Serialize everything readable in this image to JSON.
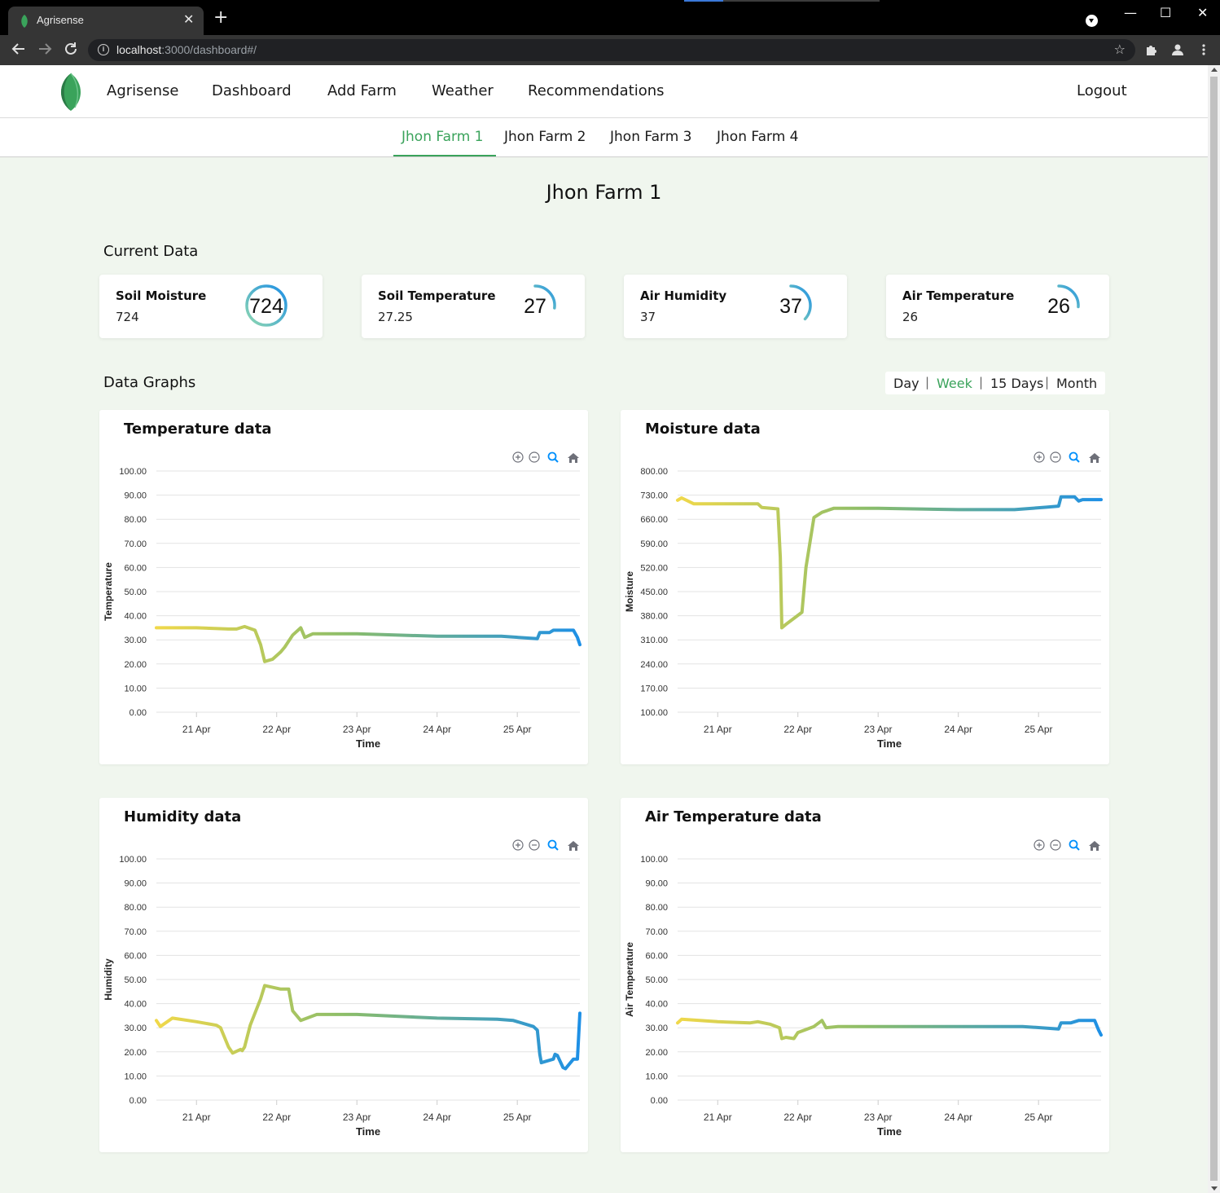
{
  "browser": {
    "tab_title": "Agrisense",
    "tab_close": "✕",
    "new_tab": "+",
    "url_host": "localhost",
    "url_rest": ":3000/dashboard#/",
    "win_min": "—",
    "win_max": "☐",
    "win_close": "✕"
  },
  "nav": {
    "brand": "Agrisense",
    "links": [
      "Dashboard",
      "Add Farm",
      "Weather",
      "Recommendations"
    ],
    "logout": "Logout"
  },
  "farm_tabs": [
    "Jhon Farm 1",
    "Jhon Farm 2",
    "Jhon Farm 3",
    "Jhon Farm 4"
  ],
  "active_farm_tab": 0,
  "page_title": "Jhon Farm 1",
  "current_data": {
    "title": "Current Data",
    "cards": [
      {
        "label": "Soil Moisture",
        "value": "724",
        "gauge": "724",
        "fraction": 1.0
      },
      {
        "label": "Soil Temperature",
        "value": "27.25",
        "gauge": "27",
        "fraction": 0.27
      },
      {
        "label": "Air Humidity",
        "value": "37",
        "gauge": "37",
        "fraction": 0.37
      },
      {
        "label": "Air Temperature",
        "value": "26",
        "gauge": "26",
        "fraction": 0.26
      }
    ]
  },
  "graphs": {
    "title": "Data Graphs",
    "ranges": [
      "Day",
      "Week",
      "15 Days",
      "Month"
    ],
    "active_range": "Week",
    "separator": "|"
  },
  "colors": {
    "accent_green": "#3aa35b",
    "gradient_start": "#f0d84a",
    "gradient_mid": "#8bbd6a",
    "gradient_end": "#1e90e6"
  },
  "toolbar_icons": [
    "zoom-in-icon",
    "zoom-out-icon",
    "selection-zoom-icon",
    "reset-home-icon"
  ],
  "chart_data": [
    {
      "type": "line",
      "title": "Temperature data",
      "xlabel": "Time",
      "ylabel": "Temperature",
      "ylim": [
        0,
        100
      ],
      "yticks": [
        "100.00",
        "90.00",
        "80.00",
        "70.00",
        "60.00",
        "50.00",
        "40.00",
        "30.00",
        "20.00",
        "10.00",
        "0.00"
      ],
      "xticks": [
        "21 Apr",
        "22 Apr",
        "23 Apr",
        "24 Apr",
        "25 Apr"
      ],
      "xlim": [
        20.5,
        25.78
      ],
      "grid": true,
      "x": [
        20.5,
        21.0,
        21.4,
        21.5,
        21.6,
        21.73,
        21.8,
        21.85,
        21.95,
        22.05,
        22.1,
        22.2,
        22.3,
        22.35,
        22.45,
        23.0,
        24.0,
        24.8,
        25.25,
        25.28,
        25.4,
        25.45,
        25.55,
        25.7,
        25.75,
        25.78
      ],
      "y": [
        35,
        35,
        34.5,
        34.5,
        35.5,
        34,
        28,
        21,
        22,
        25,
        27,
        32,
        35,
        31,
        32.5,
        32.5,
        31.5,
        31.5,
        30.5,
        33,
        33,
        34,
        34,
        34,
        31,
        28
      ]
    },
    {
      "type": "line",
      "title": "Moisture data",
      "xlabel": "Time",
      "ylabel": "Moisture",
      "ylim": [
        100,
        800
      ],
      "yticks": [
        "800.00",
        "730.00",
        "660.00",
        "590.00",
        "520.00",
        "450.00",
        "380.00",
        "310.00",
        "240.00",
        "170.00",
        "100.00"
      ],
      "xticks": [
        "21 Apr",
        "22 Apr",
        "23 Apr",
        "24 Apr",
        "25 Apr"
      ],
      "xlim": [
        20.5,
        25.78
      ],
      "grid": true,
      "x": [
        20.5,
        20.55,
        20.7,
        21.4,
        21.5,
        21.55,
        21.75,
        21.78,
        21.8,
        21.85,
        22.05,
        22.1,
        22.2,
        22.3,
        22.45,
        23.0,
        24.0,
        24.7,
        25.1,
        25.25,
        25.28,
        25.45,
        25.5,
        25.55,
        25.78
      ],
      "y": [
        715,
        722,
        705,
        705,
        705,
        694,
        690,
        550,
        345,
        355,
        390,
        520,
        665,
        680,
        692,
        692,
        688,
        688,
        695,
        698,
        725,
        725,
        713,
        717,
        717
      ]
    },
    {
      "type": "line",
      "title": "Humidity data",
      "xlabel": "Time",
      "ylabel": "Humidity",
      "ylim": [
        0,
        100
      ],
      "yticks": [
        "100.00",
        "90.00",
        "80.00",
        "70.00",
        "60.00",
        "50.00",
        "40.00",
        "30.00",
        "20.00",
        "10.00",
        "0.00"
      ],
      "xticks": [
        "21 Apr",
        "22 Apr",
        "23 Apr",
        "24 Apr",
        "25 Apr"
      ],
      "xlim": [
        20.5,
        25.78
      ],
      "grid": true,
      "x": [
        20.5,
        20.55,
        20.7,
        21.0,
        21.25,
        21.3,
        21.4,
        21.45,
        21.55,
        21.57,
        21.6,
        21.67,
        21.8,
        21.85,
        22.05,
        22.15,
        22.2,
        22.3,
        22.5,
        23.0,
        24.0,
        24.75,
        24.95,
        25.2,
        25.25,
        25.28,
        25.3,
        25.45,
        25.47,
        25.5,
        25.57,
        25.6,
        25.7,
        25.75,
        25.78
      ],
      "y": [
        33,
        30.5,
        34,
        32.5,
        31,
        30,
        22,
        19.5,
        21,
        20.5,
        22,
        31,
        42,
        47.5,
        46,
        46,
        37,
        33,
        35.5,
        35.5,
        34,
        33.5,
        33,
        30.5,
        29,
        19,
        15.5,
        17,
        19,
        18.5,
        13.5,
        13,
        17,
        17,
        36
      ]
    },
    {
      "type": "line",
      "title": "Air Temperature data",
      "xlabel": "Time",
      "ylabel": "Air Temperature",
      "ylim": [
        0,
        100
      ],
      "yticks": [
        "100.00",
        "90.00",
        "80.00",
        "70.00",
        "60.00",
        "50.00",
        "40.00",
        "30.00",
        "20.00",
        "10.00",
        "0.00"
      ],
      "xticks": [
        "21 Apr",
        "22 Apr",
        "23 Apr",
        "24 Apr",
        "25 Apr"
      ],
      "xlim": [
        20.5,
        25.78
      ],
      "grid": true,
      "x": [
        20.5,
        20.55,
        21.0,
        21.4,
        21.5,
        21.65,
        21.77,
        21.8,
        21.85,
        21.95,
        22.0,
        22.2,
        22.3,
        22.35,
        22.5,
        23.0,
        24.0,
        24.8,
        25.25,
        25.28,
        25.4,
        25.5,
        25.6,
        25.7,
        25.75,
        25.78
      ],
      "y": [
        32,
        33.5,
        32.5,
        32,
        32.5,
        31.5,
        30,
        25.5,
        26,
        25.5,
        28,
        30.5,
        33,
        30,
        30.5,
        30.5,
        30.5,
        30.5,
        29.5,
        32,
        32,
        33,
        33,
        33,
        29,
        27
      ]
    }
  ]
}
